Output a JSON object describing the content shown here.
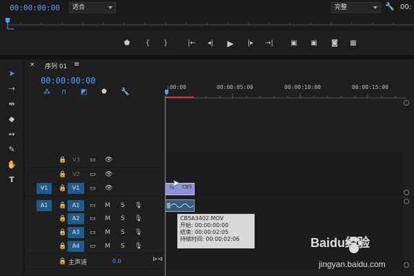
{
  "program_monitor": {
    "timecode": "00:00:00:00",
    "fit": "适合",
    "quality": "完整",
    "right_timecode": "00:"
  },
  "transport_icons": [
    "marker-icon",
    "mark-in-icon",
    "mark-out-icon",
    "go-to-in-icon",
    "step-back-icon",
    "play-icon",
    "step-forward-icon",
    "go-to-out-icon",
    "lift-icon",
    "extract-icon",
    "export-frame-icon",
    "button-editor-icon"
  ],
  "sequence": {
    "tab_title": "序列 01",
    "timecode": "00:00:00:00"
  },
  "ruler": {
    "ticks": [
      ":00:00",
      "00:00:05:00",
      "00:00:10:00",
      "00:00:15:00"
    ]
  },
  "tracks": {
    "video": [
      {
        "target": "V3",
        "source": ""
      },
      {
        "target": "V2",
        "source": ""
      },
      {
        "target": "V1",
        "source": "V1"
      }
    ],
    "audio": [
      {
        "target": "A1",
        "source": "A1",
        "m": "M",
        "s": "S"
      },
      {
        "target": "A2",
        "source": "",
        "m": "M",
        "s": "S"
      },
      {
        "target": "A3",
        "source": "",
        "m": "M",
        "s": "S"
      },
      {
        "target": "A4",
        "source": "",
        "m": "M",
        "s": "S"
      }
    ],
    "master": {
      "label": "主声道",
      "value": "0.0"
    }
  },
  "clip": {
    "video_label": "CB5"
  },
  "tooltip": {
    "filename": "CB5A3402.MOV",
    "start": "开始: 00:00:00:00",
    "end": "结束: 00:00:02:05",
    "duration": "持续时间: 00:00:02:06"
  },
  "watermark": {
    "brand": "Baidu经验",
    "url": "jingyan.baidu.com"
  }
}
